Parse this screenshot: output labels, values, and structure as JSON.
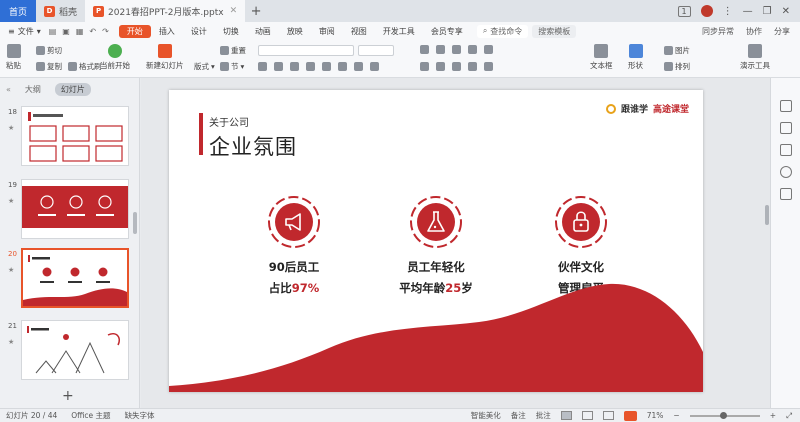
{
  "tabs": {
    "home": "首页",
    "straw": "稻壳",
    "doc": "2021春招PPT-2月版本.pptx",
    "page_badge": "1"
  },
  "menu": {
    "file": "文件",
    "items": [
      "开始",
      "插入",
      "设计",
      "切换",
      "动画",
      "放映",
      "审阅",
      "视图",
      "开发工具",
      "会员专享"
    ],
    "active_index": 0,
    "search_cmd": "查找命令",
    "search_tmpl": "搜索模板",
    "right": [
      "同步异常",
      "协作",
      "分享"
    ]
  },
  "ribbon": {
    "paste": "粘贴",
    "cut": "剪切",
    "copy": "复制",
    "format_painter": "格式刷",
    "from_current": "当前开始",
    "new_slide": "新建幻灯片",
    "layout": "版式",
    "section": "节",
    "reset": "重置",
    "textbox": "文本框",
    "shape": "形状",
    "picture": "图片",
    "arrange": "排列",
    "present_tools": "演示工具"
  },
  "panel": {
    "outline": "大纲",
    "slides": "幻灯片",
    "thumbs": [
      {
        "num": "18",
        "selected": false
      },
      {
        "num": "19",
        "selected": false
      },
      {
        "num": "20",
        "selected": true
      },
      {
        "num": "21",
        "selected": false
      }
    ]
  },
  "slide": {
    "subtitle": "关于公司",
    "title": "企业氛围",
    "logo_name1": "跟谁学",
    "logo_name2": "高途课堂",
    "columns": [
      {
        "line1": "90后员工",
        "line2_pre": "占比",
        "line2_hl": "97%",
        "line2_post": "",
        "icon": "megaphone-icon"
      },
      {
        "line1": "员工年轻化",
        "line2_pre": "平均年龄",
        "line2_hl": "25",
        "line2_post": "岁",
        "icon": "flask-icon"
      },
      {
        "line1": "伙伴文化",
        "line2_pre": "管理扁平",
        "line2_hl": "",
        "line2_post": "",
        "icon": "lock-icon"
      }
    ],
    "accent_color": "#c0282d"
  },
  "status": {
    "slide_info": "幻灯片 20 / 44",
    "theme": "Office 主题",
    "missing_font": "缺失字体",
    "smart_beautify": "智能美化",
    "notes": "备注",
    "comments": "批注",
    "zoom": "71%"
  }
}
